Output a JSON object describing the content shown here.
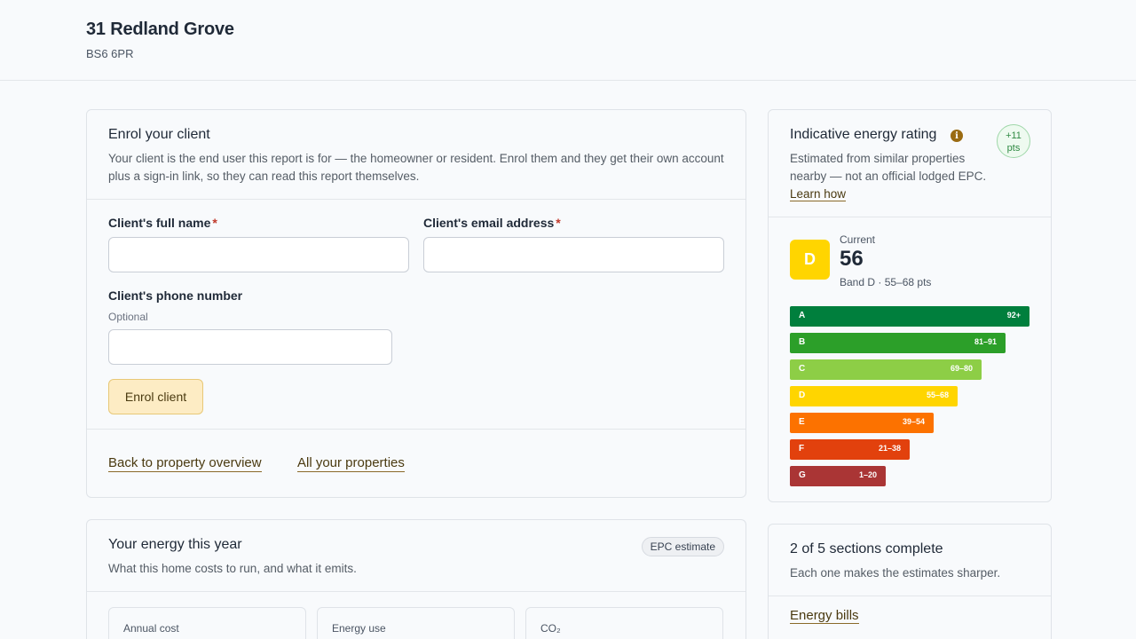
{
  "property": {
    "address": "31 Redland Grove",
    "postcode": "BS6 6PR"
  },
  "enrol": {
    "title": "Enrol your client",
    "description": "Your client is the end user this report is for — the homeowner or resident. Enrol them and they get their own account plus a sign-in link, so they can read this report themselves.",
    "name_label": "Client's full name",
    "email_label": "Client's email address",
    "required_mark": "*",
    "phone_label": "Client's phone number",
    "phone_hint": "Optional",
    "name_value": "",
    "email_value": "",
    "phone_value": "",
    "button": "Enrol client",
    "links": {
      "back": "Back to property overview",
      "all": "All your properties"
    }
  },
  "energy": {
    "title": "Your energy this year",
    "subtitle": "What this home costs to run, and what it emits.",
    "badge": "EPC estimate",
    "stats": [
      "Annual cost",
      "Energy use",
      "CO₂"
    ]
  },
  "rating": {
    "title": "Indicative energy rating",
    "info_icon": "i",
    "pts_change": "+11",
    "pts_unit": "pts",
    "desc": "Estimated from similar properties nearby — not an official lodged EPC.",
    "learn_link": "Learn how",
    "current_label": "Current",
    "current_score": "56",
    "current_band_letter": "D",
    "current_band_text": "Band D · 55–68 pts",
    "bands": [
      {
        "letter": "A",
        "range": "92+",
        "color": "#007f3d",
        "width_frac": 1.0
      },
      {
        "letter": "B",
        "range": "81–91",
        "color": "#2c9f29",
        "width_frac": 0.9
      },
      {
        "letter": "C",
        "range": "69–80",
        "color": "#8dce46",
        "width_frac": 0.8
      },
      {
        "letter": "D",
        "range": "55–68",
        "color": "#ffd500",
        "width_frac": 0.7
      },
      {
        "letter": "E",
        "range": "39–54",
        "color": "#fc7200",
        "width_frac": 0.6
      },
      {
        "letter": "F",
        "range": "21–38",
        "color": "#e2410d",
        "width_frac": 0.5
      },
      {
        "letter": "G",
        "range": "1–20",
        "color": "#aa3535",
        "width_frac": 0.4
      }
    ]
  },
  "sections": {
    "title": "2 of 5 sections complete",
    "subtitle": "Each one makes the estimates sharper.",
    "first_link": "Energy bills"
  }
}
